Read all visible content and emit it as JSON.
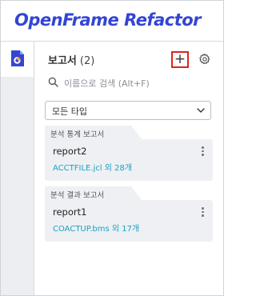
{
  "app": {
    "logo_text": "OpenFrame Refactor",
    "brand_color": "#3345d4"
  },
  "rail": {
    "items": [
      {
        "icon": "report-document-icon",
        "active": true
      }
    ]
  },
  "panel": {
    "title": "보고서",
    "count": "(2)",
    "add_button": {
      "label": "+",
      "highlight_color": "#e0241b"
    },
    "settings_icon": "gear-icon"
  },
  "search": {
    "placeholder": "이름으로 검색 (Alt+F)",
    "value": ""
  },
  "filter": {
    "selected": "모든 타입",
    "icon": "chevron-down-icon"
  },
  "groups": [
    {
      "title": "분석 통계 보고서",
      "card": {
        "name": "report2",
        "file": "ACCTFILE.jcl 외 28개"
      }
    },
    {
      "title": "분석 결과 보고서",
      "card": {
        "name": "report1",
        "file": "COACTUP.bms 외 17개"
      }
    }
  ],
  "colors": {
    "link": "#1aa0c4",
    "card_bg": "#eef0f3",
    "rail_bg": "#eceef1"
  }
}
